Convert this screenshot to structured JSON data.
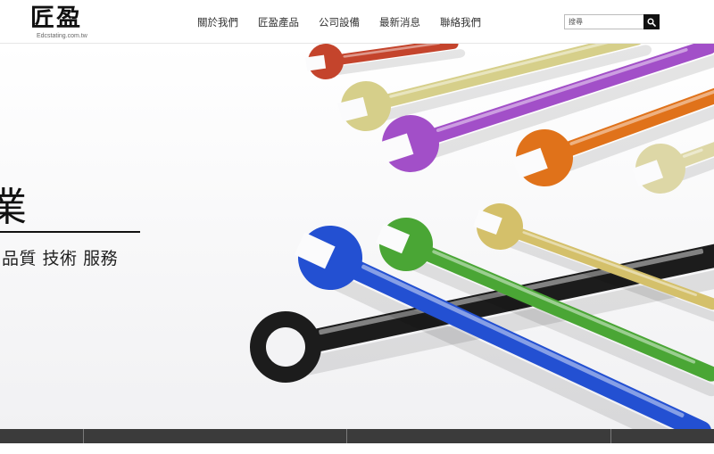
{
  "logo": {
    "mark": "匠盈",
    "sub": "Edcstating.com.tw"
  },
  "nav": {
    "items": [
      {
        "label": "關於我們"
      },
      {
        "label": "匠盈產品"
      },
      {
        "label": "公司設備"
      },
      {
        "label": "最新消息"
      },
      {
        "label": "聯絡我們"
      }
    ]
  },
  "search": {
    "placeholder": "搜尋",
    "icon": "search-icon"
  },
  "hero": {
    "title": "業",
    "subtitle": "品質 技術 服務",
    "wrench_colors": [
      "#c4442c",
      "#d6cf8a",
      "#a24fc8",
      "#e0721a",
      "#ddd7a6",
      "#2350d2",
      "#4aa635",
      "#d4c06a",
      "#1c1c1c"
    ]
  }
}
